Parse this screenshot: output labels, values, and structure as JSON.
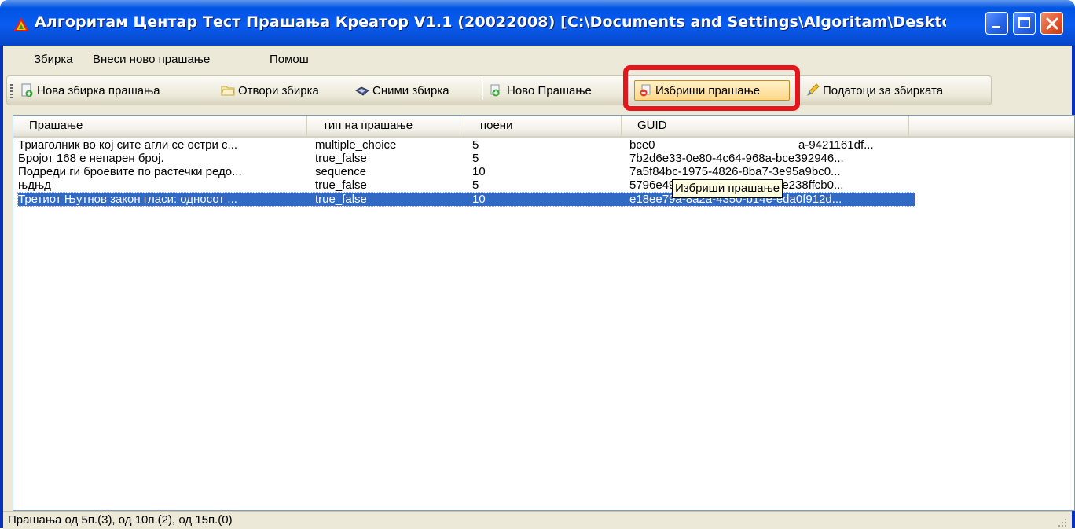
{
  "window": {
    "title": "Алгоритам Центар Тест Прашања Креатор V1.1 (20022008) [C:\\Documents and Settings\\Algoritam\\Desktop\\M..."
  },
  "menu": {
    "items": [
      "Збирка",
      "Внеси ново прашање",
      "Помош"
    ]
  },
  "toolbar": {
    "new_collection": "Нова збирка прашања",
    "open_collection": "Отвори збирка",
    "save_collection": "Сними збирка",
    "new_question": "Ново Прашање",
    "delete_question": "Избриши прашање",
    "collection_info": "Податоци за збирката"
  },
  "list": {
    "columns": [
      "Прашање",
      "тип на прашање",
      "поени",
      "GUID"
    ],
    "rows": [
      {
        "question": "Триаголник во кој сите агли се остри с...",
        "type": "multiple_choice",
        "points": "5",
        "guid": "bce0",
        "guid_tail": "a-9421161df..."
      },
      {
        "question": "Бројот 168 е непарен број.",
        "type": "true_false",
        "points": "5",
        "guid": "7b2d6e33-0e80-4c64-968a-bce392946..."
      },
      {
        "question": "Подреди ги броевите по растечки редо...",
        "type": "sequence",
        "points": "10",
        "guid": "7a5f84bc-1975-4826-8ba7-3e95a9bc0..."
      },
      {
        "question": "њдњд",
        "type": "true_false",
        "points": "5",
        "guid": "5796e496-d9cd-42e9-b685-8e238ffcb0..."
      },
      {
        "question": "Третиот Њутнов закон гласи: односот ...",
        "type": "true_false",
        "points": "10",
        "guid": "e18ee79a-8a2a-4350-b14e-eda0f912d..."
      }
    ],
    "selected_index": 4
  },
  "tooltip": "Избриши прашање",
  "status": "Прашања од 5п.(3), од 10п.(2), од 15п.(0)",
  "colors": {
    "titlebar": "#0054e3",
    "selection": "#316ac5",
    "highlight": "#e8141c",
    "tooltip_bg": "#ffffe1"
  }
}
